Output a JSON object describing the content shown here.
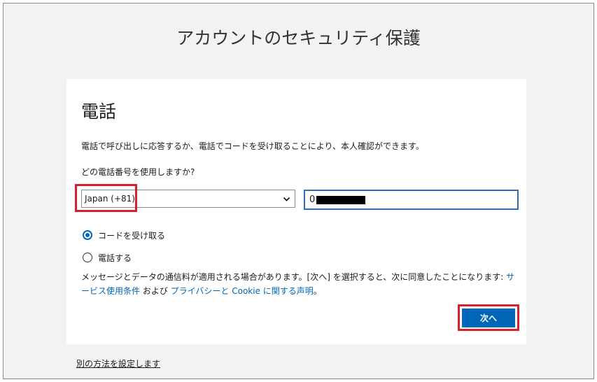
{
  "page": {
    "heading": "アカウントのセキュリティ保護"
  },
  "card": {
    "title": "電話",
    "description": "電話で呼び出しに応答するか、電話でコードを受け取ることにより、本人確認ができます。",
    "question": "どの電話番号を使用しますか?"
  },
  "country_select": {
    "selected": "Japan (+81)"
  },
  "phone_input": {
    "visible_prefix": "0"
  },
  "options": {
    "receive_code": "コードを受け取る",
    "call": "電話する",
    "selected": "receive_code"
  },
  "legal": {
    "text_before": "メッセージとデータの通信料が適用される場合があります。[次へ] を選択すると、次に同意したことになります: ",
    "terms_link": "サービス使用条件",
    "and_text": " および ",
    "privacy_link": "プライバシーと Cookie に関する声明",
    "period": "。"
  },
  "next_button": {
    "label": "次へ"
  },
  "footer": {
    "alt_method_link": "別の方法を設定します"
  },
  "colors": {
    "accent": "#0067b8",
    "highlight": "#d6202a",
    "background": "#f2f2f2"
  }
}
